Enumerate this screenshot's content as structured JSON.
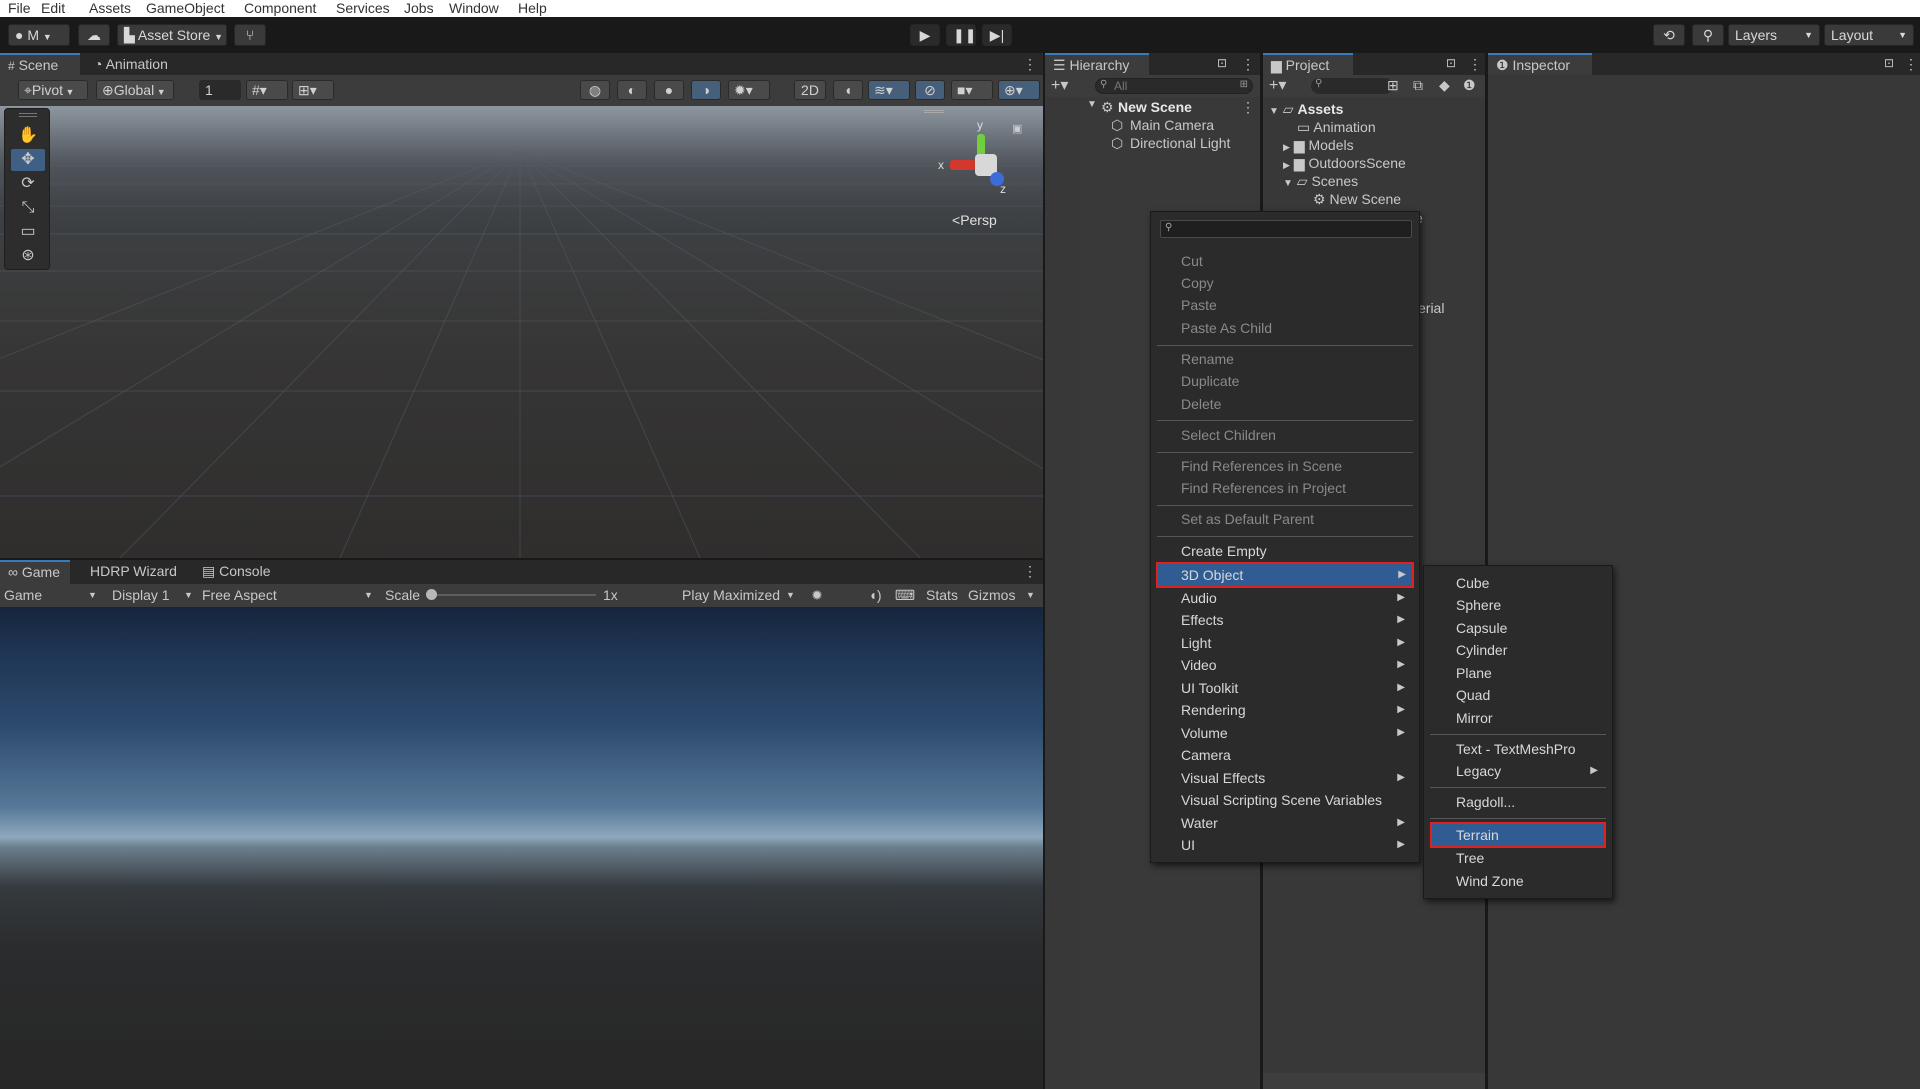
{
  "menubar": {
    "items": [
      "File",
      "Edit",
      "Assets",
      "GameObject",
      "Component",
      "Services",
      "Jobs",
      "Window",
      "Help"
    ]
  },
  "toolbar": {
    "account_label": "M",
    "asset_store_label": "Asset Store",
    "layers_label": "Layers",
    "layout_label": "Layout"
  },
  "scene_tabs": {
    "scene": "Scene",
    "animation": "Animation"
  },
  "scene_toolbar": {
    "pivot": "Pivot",
    "global": "Global",
    "grid_value": "1",
    "mode_2d": "2D"
  },
  "scene_gizmo": {
    "y": "y",
    "x": "x",
    "z": "z",
    "persp": "Persp"
  },
  "game_tabs": {
    "game": "Game",
    "hdrp": "HDRP Wizard",
    "console": "Console"
  },
  "game_toolbar": {
    "game_select": "Game",
    "display": "Display 1",
    "aspect": "Free Aspect",
    "scale_label": "Scale",
    "scale_value": "1x",
    "scale_fraction": 0,
    "play_mode": "Play Maximized",
    "stats": "Stats",
    "gizmos": "Gizmos"
  },
  "hierarchy": {
    "tab": "Hierarchy",
    "search_placeholder": "All",
    "scene_name": "New Scene",
    "items": [
      "Main Camera",
      "Directional Light"
    ]
  },
  "project": {
    "tab": "Project",
    "assets": "Assets",
    "folders": [
      "Animation",
      "Models",
      "OutdoorsScene",
      "Scenes"
    ],
    "scene_file": "New Scene",
    "partial_1": "e",
    "partial_2": "erial"
  },
  "inspector": {
    "tab": "Inspector"
  },
  "context_menu": {
    "group1": [
      "Cut",
      "Copy",
      "Paste",
      "Paste As Child"
    ],
    "group2": [
      "Rename",
      "Duplicate",
      "Delete"
    ],
    "group3": [
      "Select Children"
    ],
    "group4": [
      "Find References in Scene",
      "Find References in Project"
    ],
    "group5": [
      "Set as Default Parent"
    ],
    "create_empty": "Create Empty",
    "submenus": [
      "3D Object",
      "Audio",
      "Effects",
      "Light",
      "Video",
      "UI Toolkit",
      "Rendering",
      "Volume"
    ],
    "camera": "Camera",
    "visual_effects": "Visual Effects",
    "visual_scripting": "Visual Scripting Scene Variables",
    "water": "Water",
    "ui": "UI"
  },
  "submenu_3d": {
    "group1": [
      "Cube",
      "Sphere",
      "Capsule",
      "Cylinder",
      "Plane",
      "Quad",
      "Mirror"
    ],
    "textmeshpro": "Text - TextMeshPro",
    "legacy": "Legacy",
    "ragdoll": "Ragdoll...",
    "terrain": "Terrain",
    "tree": "Tree",
    "wind_zone": "Wind Zone"
  },
  "colors": {
    "accent": "#2f5c93",
    "highlight_outline": "#e0211e",
    "selection": "#3a79bb"
  }
}
